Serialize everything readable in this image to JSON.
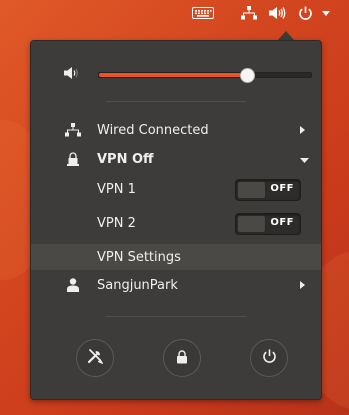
{
  "top_panel": {
    "icons": [
      "keyboard-icon",
      "network-wired-icon",
      "volume-icon",
      "power-icon"
    ]
  },
  "menu": {
    "volume": {
      "icon": "volume-low-icon",
      "level": 0.7
    },
    "wired": {
      "icon": "network-wired-icon",
      "label": "Wired Connected"
    },
    "vpn": {
      "icon": "vpn-lock-icon",
      "label": "VPN Off",
      "items": [
        {
          "label": "VPN 1",
          "state": "OFF"
        },
        {
          "label": "VPN 2",
          "state": "OFF"
        }
      ],
      "settings_label": "VPN Settings"
    },
    "user": {
      "icon": "user-icon",
      "label": "SangjunPark"
    },
    "actions": [
      "settings-icon",
      "lock-icon",
      "power-icon"
    ]
  },
  "colors": {
    "accent": "#e95420",
    "menu_bg": "#3d3c3a",
    "text": "#efefef"
  }
}
